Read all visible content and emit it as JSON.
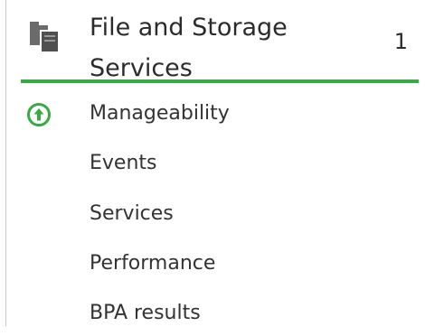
{
  "group": {
    "title_line1": "File and Storage",
    "title_line2": "Services",
    "count": "1",
    "accent_color": "#39a845",
    "icon": "folder-server-icon"
  },
  "rows": [
    {
      "label": "Manageability",
      "icon": "up-arrow-circle-icon",
      "status_color": "#39a845"
    },
    {
      "label": "Events"
    },
    {
      "label": "Services"
    },
    {
      "label": "Performance"
    },
    {
      "label": "BPA results"
    }
  ]
}
